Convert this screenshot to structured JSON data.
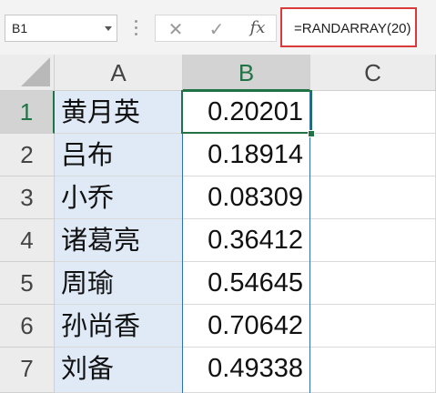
{
  "name_box": {
    "value": "B1"
  },
  "formula_bar": {
    "cancel_glyph": "✕",
    "enter_glyph": "✓",
    "fx_label": "fx",
    "formula": "=RANDARRAY(20)"
  },
  "columns": [
    "A",
    "B",
    "C"
  ],
  "rows": [
    {
      "num": "1",
      "a": "黄月英",
      "b": "0.20201"
    },
    {
      "num": "2",
      "a": "吕布",
      "b": "0.18914"
    },
    {
      "num": "3",
      "a": "小乔",
      "b": "0.08309"
    },
    {
      "num": "4",
      "a": "诸葛亮",
      "b": "0.36412"
    },
    {
      "num": "5",
      "a": "周瑜",
      "b": "0.54645"
    },
    {
      "num": "6",
      "a": "孙尚香",
      "b": "0.70642"
    },
    {
      "num": "7",
      "a": "刘备",
      "b": "0.49338"
    }
  ],
  "colors": {
    "accent_green": "#217346",
    "highlight_red": "#d93a3a",
    "column_a_fill": "#dfeaf6"
  }
}
